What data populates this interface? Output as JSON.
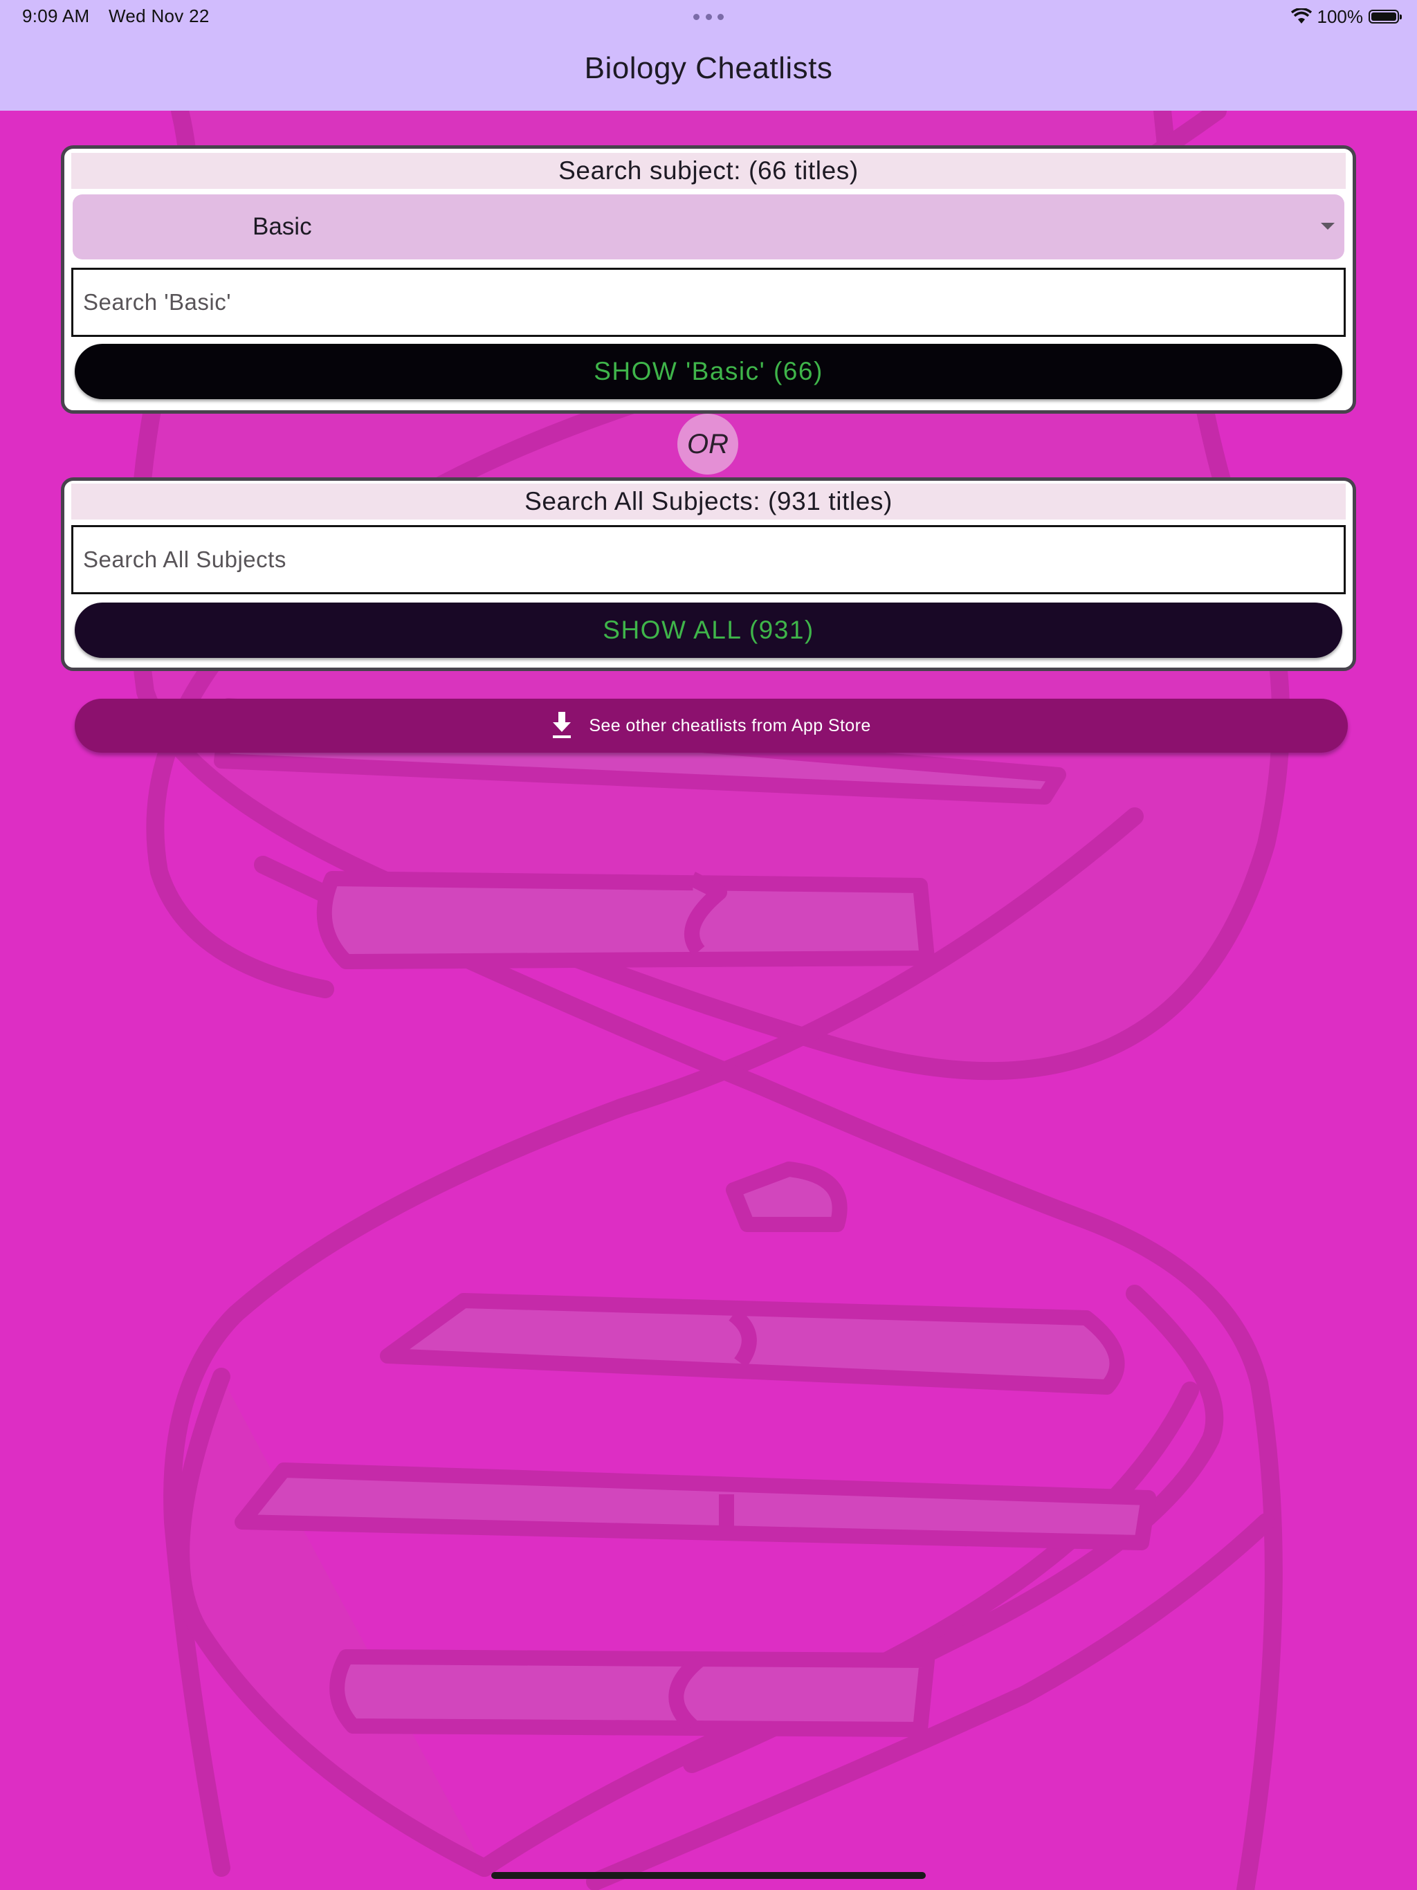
{
  "status_bar": {
    "time": "9:09 AM",
    "date": "Wed Nov 22",
    "battery": "100%",
    "icons": [
      "wifi-icon",
      "battery-icon",
      "multitask-dots-icon"
    ]
  },
  "nav": {
    "title": "Biology Cheatlists"
  },
  "subject_card": {
    "header": "Search subject: (66 titles)",
    "dropdown_value": "Basic",
    "search_placeholder": "Search 'Basic'",
    "show_button": "SHOW 'Basic' (66)"
  },
  "separator": {
    "label": "OR"
  },
  "all_card": {
    "header": "Search All Subjects: (931 titles)",
    "search_placeholder": "Search All Subjects",
    "show_button": "SHOW ALL (931)"
  },
  "store_button": {
    "label": "See other cheatlists from App Store",
    "icon": "download-icon"
  },
  "colors": {
    "background": "#dd2ec4",
    "app_bar": "#d1bcfd",
    "button_text": "#3fb54a",
    "store_button": "#8c116e"
  }
}
